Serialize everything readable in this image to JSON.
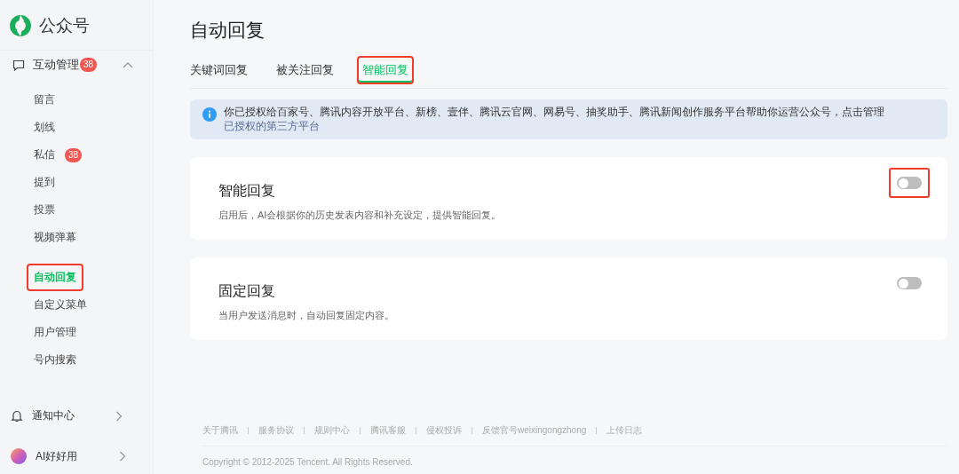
{
  "sidebar": {
    "brand": "公众号",
    "section": {
      "label": "互动管理",
      "badge": "38",
      "expanded": true,
      "groups": [
        [
          {
            "label": "留言",
            "selected": false,
            "highlighted": false
          },
          {
            "label": "划线",
            "selected": false,
            "highlighted": false
          },
          {
            "label": "私信",
            "badge": "38",
            "selected": false,
            "highlighted": false
          },
          {
            "label": "提到",
            "selected": false,
            "highlighted": false
          },
          {
            "label": "投票",
            "selected": false,
            "highlighted": false
          },
          {
            "label": "视频弹幕",
            "selected": false,
            "highlighted": false
          }
        ],
        [
          {
            "label": "自动回复",
            "selected": true,
            "highlighted": true
          },
          {
            "label": "自定义菜单",
            "selected": false,
            "highlighted": false
          },
          {
            "label": "用户管理",
            "selected": false,
            "highlighted": false
          },
          {
            "label": "号内搜索",
            "selected": false,
            "highlighted": false
          }
        ]
      ]
    },
    "bottom": [
      {
        "label": "通知中心",
        "kind": "bell"
      },
      {
        "label": "AI好好用",
        "kind": "ai"
      }
    ]
  },
  "page_title": "自动回复",
  "tabs": [
    {
      "label": "关键词回复",
      "selected": false,
      "highlighted": false
    },
    {
      "label": "被关注回复",
      "selected": false,
      "highlighted": false
    },
    {
      "label": "智能回复",
      "selected": true,
      "highlighted": true
    }
  ],
  "notice": {
    "text": "你已授权给百家号、腾讯内容开放平台、新榜、壹伴、腾讯云官网、网易号、抽奖助手、腾讯新闻创作服务平台帮助你运营公众号，点击管理",
    "link": "已授权的第三方平台"
  },
  "cards": [
    {
      "title": "智能回复",
      "description": "启用后，AI会根据你的历史发表内容和补充设定，提供智能回复。",
      "on": false,
      "highlighted": true
    },
    {
      "title": "固定回复",
      "description": "当用户发送消息时，自动回复固定内容。",
      "on": false,
      "highlighted": false
    }
  ],
  "footer": {
    "links": [
      "关于腾讯",
      "服务协议",
      "规则中心",
      "腾讯客服",
      "侵权投诉",
      "反馈官号weixingongzhong",
      "上传日志"
    ],
    "copyright": "Copyright © 2012-2025 Tencent. All Rights Reserved."
  }
}
